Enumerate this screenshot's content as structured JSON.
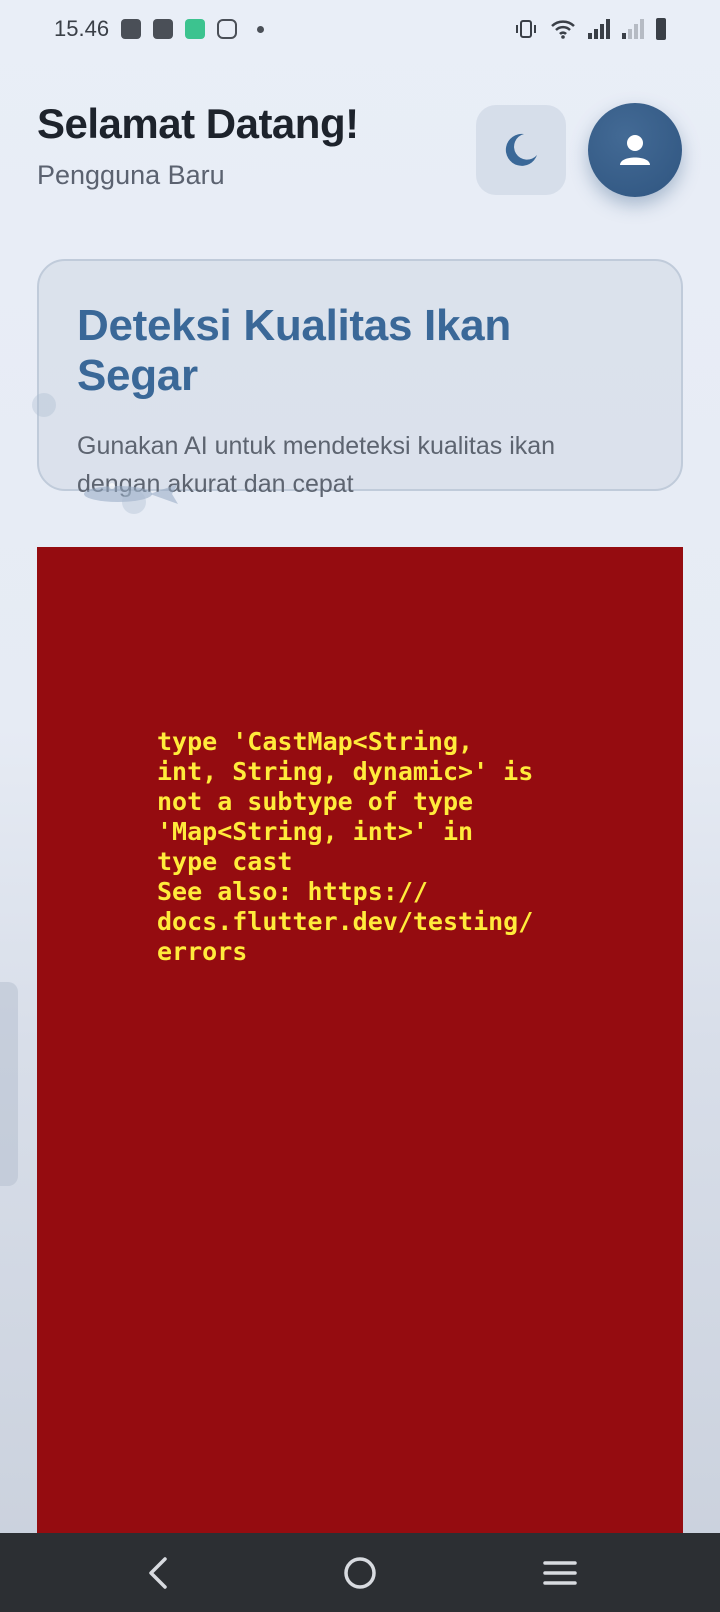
{
  "status_bar": {
    "time": "15.46",
    "notification_icons": [
      "robot-icon",
      "facebook-icon",
      "vidio-icon",
      "instagram-icon",
      "dot-icon"
    ],
    "system_icons": [
      "vibrate-icon",
      "wifi-icon",
      "signal-icon",
      "signal-weak-icon",
      "battery-icon"
    ]
  },
  "header": {
    "welcome": "Selamat Datang!",
    "subtitle": "Pengguna Baru"
  },
  "hero": {
    "title": "Deteksi Kualitas Ikan Segar",
    "description": "Gunakan AI untuk mendeteksi kualitas ikan dengan akurat dan cepat"
  },
  "error": {
    "message": "type 'CastMap<String,\nint, String, dynamic>' is\nnot a subtype of type\n'Map<String, int>' in\ntype cast\nSee also: https://\ndocs.flutter.dev/testing/\nerrors"
  },
  "colors": {
    "accent": "#3a6898",
    "avatar": "#2f5580",
    "error_bg": "#950c10",
    "error_text": "#ffeb3b"
  }
}
